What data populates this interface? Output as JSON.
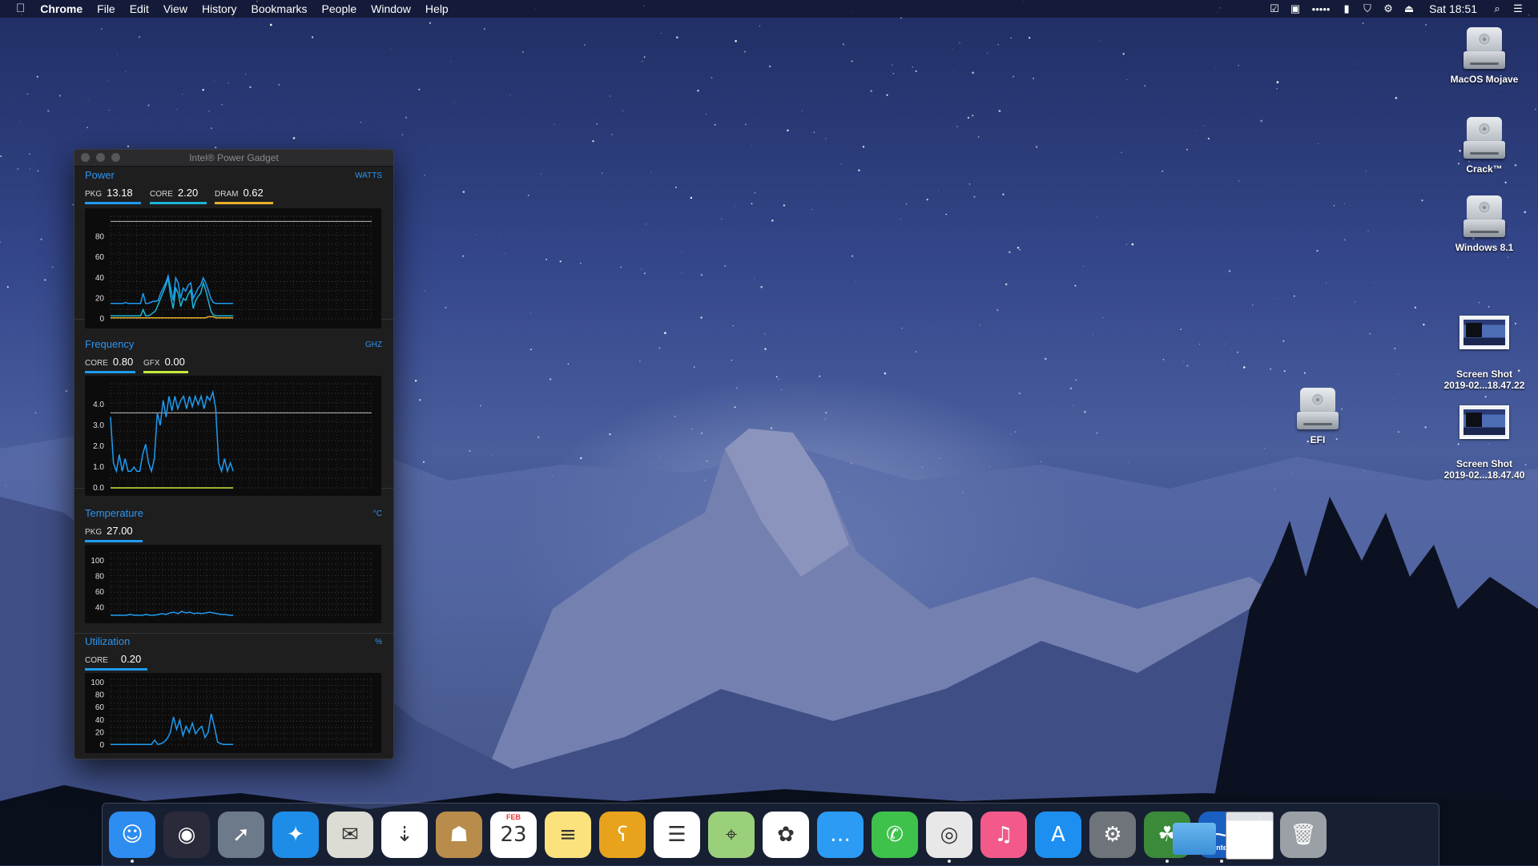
{
  "menubar": {
    "app_name": "Chrome",
    "items": [
      "File",
      "Edit",
      "View",
      "History",
      "Bookmarks",
      "People",
      "Window",
      "Help"
    ],
    "status_icons": [
      "checkbox-icon",
      "notification-icon",
      "dots-icon",
      "battery-icon",
      "shield-icon",
      "gear-icon",
      "eject-icon"
    ],
    "clock": "Sat 18:51"
  },
  "desktop": {
    "icons": [
      {
        "label": "MacOS Mojave",
        "kind": "drive"
      },
      {
        "label": "Crack™",
        "kind": "drive"
      },
      {
        "label": "Windows 8.1",
        "kind": "drive"
      },
      {
        "label": "Screen Shot\n2019-02...18.47.22",
        "kind": "screenshot"
      },
      {
        "label": "Screen Shot\n2019-02...18.47.40",
        "kind": "screenshot"
      },
      {
        "label": "EFI",
        "kind": "drive"
      }
    ]
  },
  "gadget": {
    "title": "Intel® Power Gadget",
    "colors": {
      "blue": "#1e9bf0",
      "yellow": "#e8b02c",
      "green": "#c7e83b",
      "grid": "#4a4a4c"
    },
    "power": {
      "title": "Power",
      "unit": "WATTS",
      "readings": [
        {
          "label": "PKG",
          "value": "13.18",
          "color": "#1e9bf0"
        },
        {
          "label": "CORE",
          "value": "2.20",
          "color": "#1ab6d8"
        },
        {
          "label": "DRAM",
          "value": "0.62",
          "color": "#e8b02c"
        }
      ],
      "ticks": [
        "80",
        "60",
        "40",
        "20",
        "0"
      ],
      "ymax": 100,
      "series": [
        {
          "name": "PKG",
          "color": "#1e9bf0",
          "values": [
            15,
            15,
            15,
            15,
            15,
            15,
            16,
            15,
            15,
            15,
            15,
            15,
            15,
            25,
            15,
            15,
            16,
            17,
            17,
            18,
            25,
            30,
            35,
            42,
            30,
            18,
            40,
            35,
            20,
            30,
            27,
            33,
            35,
            20,
            25,
            30,
            33,
            40,
            35,
            28,
            20,
            16,
            15,
            15,
            15,
            15,
            15,
            15,
            15,
            15
          ]
        },
        {
          "name": "CORE",
          "color": "#1ab6d8",
          "values": [
            3,
            3,
            3,
            3,
            3,
            3,
            3,
            3,
            3,
            3,
            3,
            3,
            3,
            9,
            3,
            3,
            4,
            6,
            8,
            14,
            20,
            26,
            32,
            40,
            22,
            10,
            30,
            25,
            12,
            20,
            18,
            24,
            28,
            10,
            18,
            22,
            25,
            35,
            28,
            18,
            8,
            4,
            3,
            3,
            3,
            3,
            3,
            3,
            3,
            3
          ]
        },
        {
          "name": "DRAM",
          "color": "#e8b02c",
          "values": [
            1,
            1,
            1,
            1,
            1,
            1,
            1,
            1,
            1,
            1,
            1,
            1,
            1,
            1,
            1,
            1,
            1,
            1,
            1,
            1,
            1,
            1,
            1,
            1,
            1,
            1,
            1,
            1,
            1,
            1,
            1,
            1,
            1,
            1,
            1,
            1,
            1,
            1,
            1,
            2,
            2,
            2,
            1,
            1,
            1,
            1,
            1,
            1,
            1,
            1
          ]
        }
      ],
      "limit_line": 95
    },
    "frequency": {
      "title": "Frequency",
      "unit": "GHZ",
      "readings": [
        {
          "label": "CORE",
          "value": "0.80",
          "color": "#1e9bf0"
        },
        {
          "label": "GFX",
          "value": "0.00",
          "color": "#c7e83b"
        }
      ],
      "ticks": [
        "4.0",
        "3.0",
        "2.0",
        "1.0",
        "0.0"
      ],
      "ymax": 5,
      "series": [
        {
          "name": "CORE",
          "color": "#1e9bf0",
          "values": [
            3.4,
            1.2,
            0.8,
            1.6,
            0.8,
            1.4,
            0.8,
            0.8,
            1.0,
            0.8,
            0.8,
            1.6,
            2.1,
            1.2,
            0.8,
            1.4,
            3.6,
            3.0,
            4.2,
            3.4,
            4.4,
            3.7,
            4.4,
            3.8,
            4.2,
            4.4,
            3.8,
            4.4,
            3.9,
            4.4,
            4.0,
            4.4,
            3.8,
            4.4,
            4.2,
            4.6,
            3.8,
            1.2,
            0.8,
            1.4,
            0.8,
            1.2,
            0.8
          ]
        },
        {
          "name": "GFX",
          "color": "#c7e83b",
          "values": [
            0,
            0,
            0,
            0,
            0,
            0,
            0,
            0,
            0,
            0,
            0,
            0,
            0,
            0,
            0,
            0,
            0,
            0,
            0,
            0,
            0,
            0,
            0,
            0,
            0,
            0,
            0,
            0,
            0,
            0,
            0,
            0,
            0,
            0,
            0,
            0,
            0,
            0,
            0,
            0,
            0,
            0,
            0
          ]
        }
      ],
      "limit_line": 3.6
    },
    "temperature": {
      "title": "Temperature",
      "unit": "°C",
      "readings": [
        {
          "label": "PKG",
          "value": "27.00",
          "color": "#1e9bf0"
        }
      ],
      "ticks": [
        "100",
        "80",
        "60",
        "40"
      ],
      "ymin": 30,
      "ymax": 110,
      "series": [
        {
          "name": "PKG",
          "color": "#1e9bf0",
          "values": [
            30,
            30,
            30,
            30,
            30,
            31,
            30,
            30,
            30,
            31,
            30,
            30,
            31,
            32,
            31,
            33,
            34,
            32,
            35,
            33,
            34,
            32,
            33,
            32,
            33,
            34,
            33,
            32,
            31,
            31,
            30,
            30
          ]
        }
      ]
    },
    "utilization": {
      "title": "Utilization",
      "unit": "%",
      "readings": [
        {
          "label": "CORE",
          "value": "0.20",
          "color": "#1e9bf0"
        }
      ],
      "ticks": [
        "100",
        "80",
        "60",
        "40",
        "20",
        "0"
      ],
      "ymax": 105,
      "series": [
        {
          "name": "CORE",
          "color": "#1e9bf0",
          "values": [
            1,
            1,
            1,
            1,
            1,
            1,
            1,
            1,
            1,
            1,
            1,
            1,
            1,
            1,
            8,
            1,
            2,
            5,
            10,
            20,
            45,
            25,
            40,
            15,
            30,
            20,
            35,
            18,
            25,
            30,
            12,
            20,
            50,
            30,
            5,
            2,
            1,
            1,
            1,
            1
          ]
        }
      ]
    }
  },
  "dock": {
    "apps": [
      {
        "name": "finder-icon",
        "glyph": "☺",
        "color": "#2d8df0",
        "running": true
      },
      {
        "name": "siri-icon",
        "glyph": "◉",
        "color": "#2a2a3a",
        "running": false
      },
      {
        "name": "launchpad-icon",
        "glyph": "➚",
        "color": "#6c7a8a",
        "running": false
      },
      {
        "name": "safari-icon",
        "glyph": "✦",
        "color": "#1d8de8",
        "running": false
      },
      {
        "name": "mail-icon",
        "glyph": "✉",
        "color": "#dcdcd4",
        "running": false
      },
      {
        "name": "istat-icon",
        "glyph": "⇣",
        "color": "#ffffff",
        "running": false
      },
      {
        "name": "contacts-icon",
        "glyph": "☗",
        "color": "#b88c4a",
        "running": false
      },
      {
        "name": "calendar-icon",
        "glyph": "23",
        "color": "#ffffff",
        "running": false,
        "caption": "FEB"
      },
      {
        "name": "notes-icon",
        "glyph": "≡",
        "color": "#fbe27c",
        "running": false
      },
      {
        "name": "tunnelbear-icon",
        "glyph": "ʕ",
        "color": "#e8a21c",
        "running": false
      },
      {
        "name": "reminders-icon",
        "glyph": "☰",
        "color": "#ffffff",
        "running": false
      },
      {
        "name": "maps-icon",
        "glyph": "⌖",
        "color": "#9bd07a",
        "running": false
      },
      {
        "name": "photos-icon",
        "glyph": "✿",
        "color": "#ffffff",
        "running": false
      },
      {
        "name": "messages-icon",
        "glyph": "…",
        "color": "#2b9bf4",
        "running": false
      },
      {
        "name": "facetime-icon",
        "glyph": "✆",
        "color": "#3ec24c",
        "running": false
      },
      {
        "name": "chrome-icon",
        "glyph": "◎",
        "color": "#e8e8e8",
        "running": true
      },
      {
        "name": "itunes-icon",
        "glyph": "♫",
        "color": "#f35a8a",
        "running": false
      },
      {
        "name": "app-store-icon",
        "glyph": "A",
        "color": "#1c8ff0",
        "running": false
      },
      {
        "name": "system-preferences-icon",
        "glyph": "⚙",
        "color": "#6f747b",
        "running": false
      },
      {
        "name": "clover-configurator-icon",
        "glyph": "☘",
        "color": "#3a8a3a",
        "running": true
      },
      {
        "name": "power-gadget-icon",
        "glyph": "⁓",
        "color": "#1a5fbf",
        "running": true,
        "caption": "intel"
      },
      {
        "name": "downloads-folder-icon",
        "glyph": "",
        "color": "#4fa3e0",
        "running": false
      },
      {
        "name": "chrome-window-icon",
        "glyph": "",
        "color": "#e9ecef",
        "running": false
      },
      {
        "name": "trash-icon",
        "glyph": "🗑",
        "color": "#9aa0a6",
        "running": false
      }
    ]
  }
}
